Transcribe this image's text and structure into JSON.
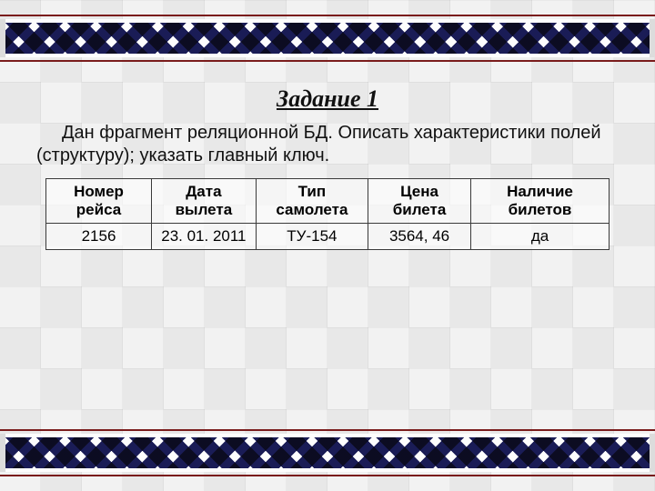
{
  "title": "Задание 1",
  "paragraph": "Дан фрагмент реляционной БД. Описать характеристики полей (структуру); указать главный ключ.",
  "table": {
    "headers": [
      "Номер рейса",
      "Дата вылета",
      "Тип самолета",
      "Цена билета",
      "Наличие билетов"
    ],
    "rows": [
      [
        "2156",
        "23. 01. 2011",
        "ТУ-154",
        "3564, 46",
        "да"
      ]
    ]
  }
}
